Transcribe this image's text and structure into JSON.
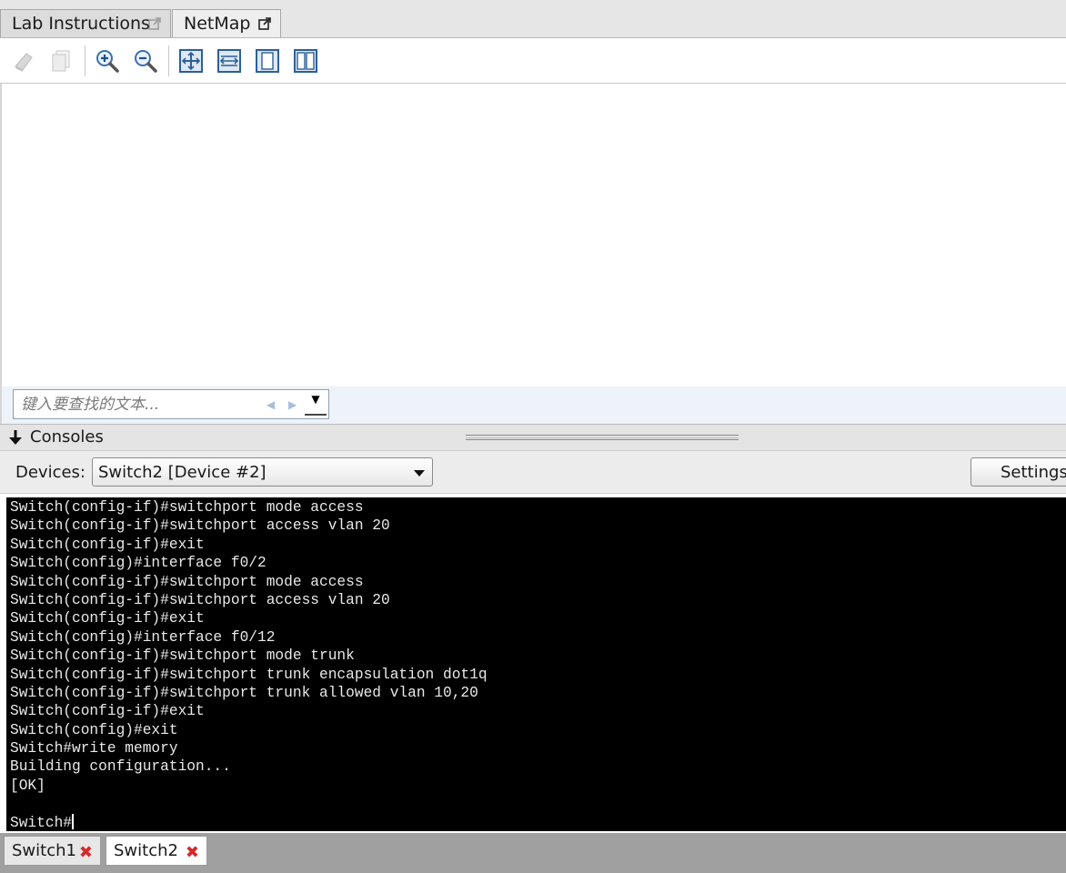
{
  "top_tabs": [
    {
      "label": "Lab Instructions",
      "icon": "popout-icon"
    },
    {
      "label": "NetMap",
      "icon": "popout-icon"
    }
  ],
  "toolbar": {
    "buttons": [
      "print-icon",
      "copy-icon",
      "zoom-in-icon",
      "zoom-out-icon",
      "fit-page-icon",
      "fit-width-icon",
      "single-page-icon",
      "two-page-icon"
    ]
  },
  "find": {
    "placeholder": "键入要查找的文本..."
  },
  "consoles": {
    "title": "Consoles"
  },
  "devices": {
    "label": "Devices:",
    "selected": "Switch2 [Device #2]",
    "settings_label": "Settings..."
  },
  "terminal": {
    "lines": [
      "Switch(config-if)#switchport mode access",
      "Switch(config-if)#switchport access vlan 20",
      "Switch(config-if)#exit",
      "Switch(config)#interface f0/2",
      "Switch(config-if)#switchport mode access",
      "Switch(config-if)#switchport access vlan 20",
      "Switch(config-if)#exit",
      "Switch(config)#interface f0/12",
      "Switch(config-if)#switchport mode trunk",
      "Switch(config-if)#switchport trunk encapsulation dot1q",
      "Switch(config-if)#switchport trunk allowed vlan 10,20",
      "Switch(config-if)#exit",
      "Switch(config)#exit",
      "Switch#write memory",
      "Building configuration...",
      "[OK]",
      "",
      "Switch#"
    ]
  },
  "bottom_tabs": [
    {
      "label": "Switch1",
      "close": "✖"
    },
    {
      "label": "Switch2",
      "close": "✖"
    }
  ],
  "colors": {
    "terminal_bg": "#000000",
    "terminal_fg": "#e8e8e8",
    "close_red": "#d42a2a",
    "find_bar_bg": "#eef3fa"
  }
}
